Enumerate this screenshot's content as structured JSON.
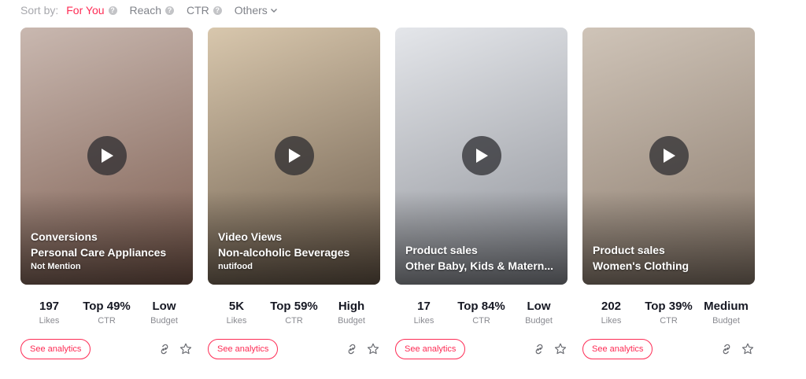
{
  "sortbar": {
    "label": "Sort by:",
    "options": [
      {
        "label": "For You",
        "active": true,
        "info": true
      },
      {
        "label": "Reach",
        "active": false,
        "info": true
      },
      {
        "label": "CTR",
        "active": false,
        "info": true
      },
      {
        "label": "Others",
        "active": false,
        "dropdown": true
      }
    ]
  },
  "accent_color": "#fe2c55",
  "cards": [
    {
      "thumb_colors": [
        "#c9b8b0",
        "#7a5a4d"
      ],
      "objective": "Conversions",
      "category": "Personal Care Appliances",
      "brand": "Not Mention",
      "stats": [
        {
          "value": "197",
          "label": "Likes"
        },
        {
          "value": "Top 49%",
          "label": "CTR"
        },
        {
          "value": "Low",
          "label": "Budget"
        }
      ],
      "cta": "See analytics"
    },
    {
      "thumb_colors": [
        "#d8c7ad",
        "#6a5a4a"
      ],
      "objective": "Video Views",
      "category": "Non-alcoholic Beverages",
      "brand": "nutifood",
      "stats": [
        {
          "value": "5K",
          "label": "Likes"
        },
        {
          "value": "Top 59%",
          "label": "CTR"
        },
        {
          "value": "High",
          "label": "Budget"
        }
      ],
      "cta": "See analytics"
    },
    {
      "thumb_colors": [
        "#e4e6ea",
        "#8c8f96"
      ],
      "objective": "Product sales",
      "category": "Other Baby, Kids & Matern...",
      "brand": "",
      "stats": [
        {
          "value": "17",
          "label": "Likes"
        },
        {
          "value": "Top 84%",
          "label": "CTR"
        },
        {
          "value": "Low",
          "label": "Budget"
        }
      ],
      "cta": "See analytics"
    },
    {
      "thumb_colors": [
        "#cfc4b8",
        "#8a7a6c"
      ],
      "objective": "Product sales",
      "category": "Women's Clothing",
      "brand": "",
      "stats": [
        {
          "value": "202",
          "label": "Likes"
        },
        {
          "value": "Top 39%",
          "label": "CTR"
        },
        {
          "value": "Medium",
          "label": "Budget"
        }
      ],
      "cta": "See analytics"
    }
  ],
  "icons": {
    "info": "question-icon",
    "dropdown": "chevron-down-icon",
    "play": "play-icon",
    "link": "link-icon",
    "favorite": "star-icon"
  }
}
